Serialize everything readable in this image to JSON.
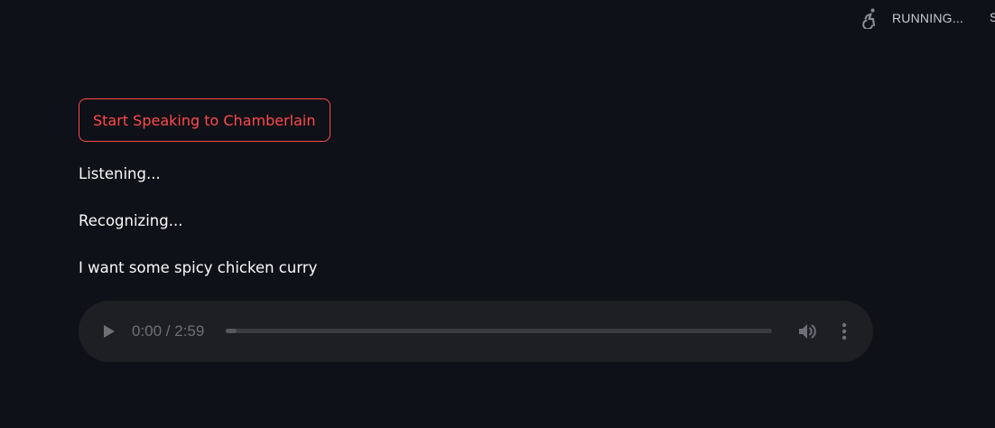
{
  "header": {
    "status_text": "RUNNING...",
    "status_icon": "running-person-icon",
    "overflow_text": "S"
  },
  "main": {
    "speak_button_label": "Start Speaking to Chamberlain",
    "messages": [
      "Listening...",
      "Recognizing...",
      "I want some spicy chicken curry"
    ]
  },
  "audio": {
    "time_text": "0:00 / 2:59",
    "current_time": "0:00",
    "duration": "2:59",
    "progress_fraction": 0.02,
    "play_icon": "play-icon",
    "volume_icon": "volume-icon",
    "menu_icon": "more-options-icon"
  },
  "colors": {
    "background": "#0e1117",
    "accent": "#ff4b4b",
    "text": "#fafafa",
    "player_background": "#1e1f23"
  }
}
